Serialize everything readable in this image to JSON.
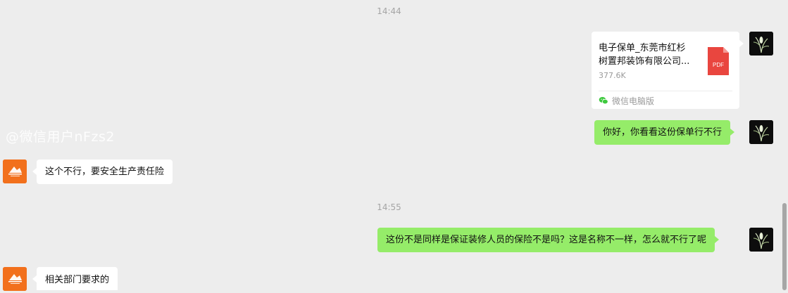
{
  "chat": {
    "timestamps": [
      "14:44",
      "14:55"
    ],
    "file_message": {
      "name_line1": "电子保单_东莞市红杉",
      "name_line2": "树置邦装饰有限公司...",
      "size": "377.6K",
      "file_type": "PDF",
      "source": "微信电脑版",
      "icon": "pdf-file-icon"
    },
    "watermark": "@微信用户nFzs2",
    "messages": [
      {
        "side": "right",
        "text": "你好，你看看这份保单行不行"
      },
      {
        "side": "left",
        "text": "这个不行，要安全生产责任险"
      },
      {
        "side": "right",
        "text": "这份不是同样是保证装修人员的保险不是吗？这是名称不一样，怎么就不行了呢"
      },
      {
        "side": "left",
        "text": "相关部门要求的"
      }
    ],
    "colors": {
      "background": "#ededed",
      "sent_bubble": "#95ec69",
      "received_bubble": "#ffffff",
      "pdf_red": "#e9463f",
      "contact_avatar": "#f2701c"
    }
  }
}
